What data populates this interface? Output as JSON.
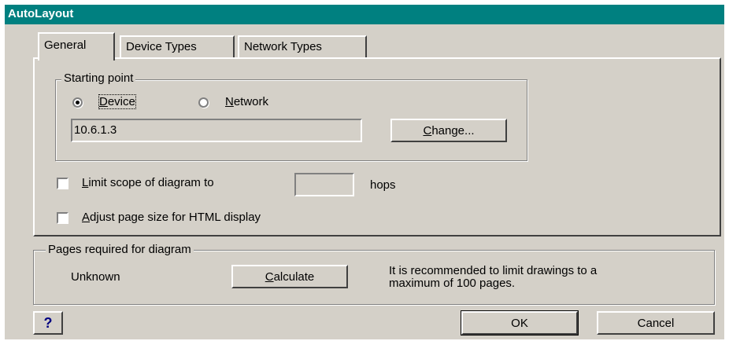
{
  "window": {
    "title": "AutoLayout"
  },
  "tabs": [
    {
      "label": "General",
      "active": true
    },
    {
      "label": "Device Types",
      "active": false
    },
    {
      "label": "Network Types",
      "active": false
    }
  ],
  "starting_point": {
    "group_label": "Starting point",
    "device": {
      "mnemonic": "D",
      "rest": "evice",
      "selected": true
    },
    "network": {
      "mnemonic": "N",
      "rest": "etwork",
      "selected": false
    },
    "value": "10.6.1.3",
    "change_button": {
      "mnemonic": "C",
      "rest": "hange..."
    }
  },
  "limit_scope": {
    "mnemonic": "L",
    "rest": "imit scope of diagram to",
    "checked": false,
    "hops_value": "",
    "hops_label": "hops"
  },
  "adjust_page": {
    "mnemonic": "A",
    "rest": "djust page size for HTML display",
    "checked": false
  },
  "pages_required": {
    "group_label": "Pages required for diagram",
    "status": "Unknown",
    "calculate_button": {
      "mnemonic": "C",
      "rest": "alculate"
    },
    "note_line1": "It is recommended to limit drawings to a",
    "note_line2": "maximum of 100 pages."
  },
  "buttons": {
    "help": "?",
    "ok": "OK",
    "cancel": "Cancel"
  },
  "colors": {
    "titlebar": "#008080",
    "face": "#d4d0c8",
    "help_icon": "#000080"
  }
}
